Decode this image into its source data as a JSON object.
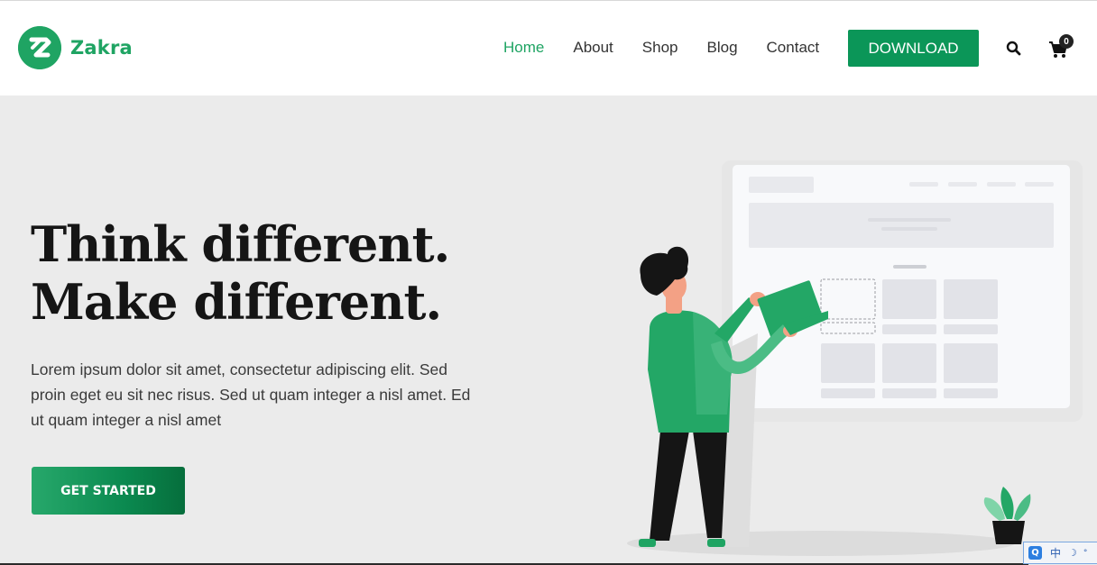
{
  "brand": {
    "name": "Zakra",
    "color": "#1fa463"
  },
  "nav": {
    "items": [
      {
        "label": "Home",
        "active": true
      },
      {
        "label": "About",
        "active": false
      },
      {
        "label": "Shop",
        "active": false
      },
      {
        "label": "Blog",
        "active": false
      },
      {
        "label": "Contact",
        "active": false
      }
    ],
    "download_label": "DOWNLOAD",
    "search_icon": "search-icon",
    "cart_icon": "cart-icon",
    "cart_count": "0"
  },
  "hero": {
    "title_line1": "Think different.",
    "title_line2": "Make different.",
    "description": "Lorem ipsum dolor sit amet, consectetur adipiscing elit. Sed proin eget eu sit nec risus. Sed ut quam integer a nisl amet.  Ed ut quam integer a nisl amet",
    "cta_label": "GET STARTED",
    "background": "#ebebeb"
  },
  "ime": {
    "logo": "Q",
    "lang": "中",
    "moon": "☽",
    "dot": "°"
  }
}
